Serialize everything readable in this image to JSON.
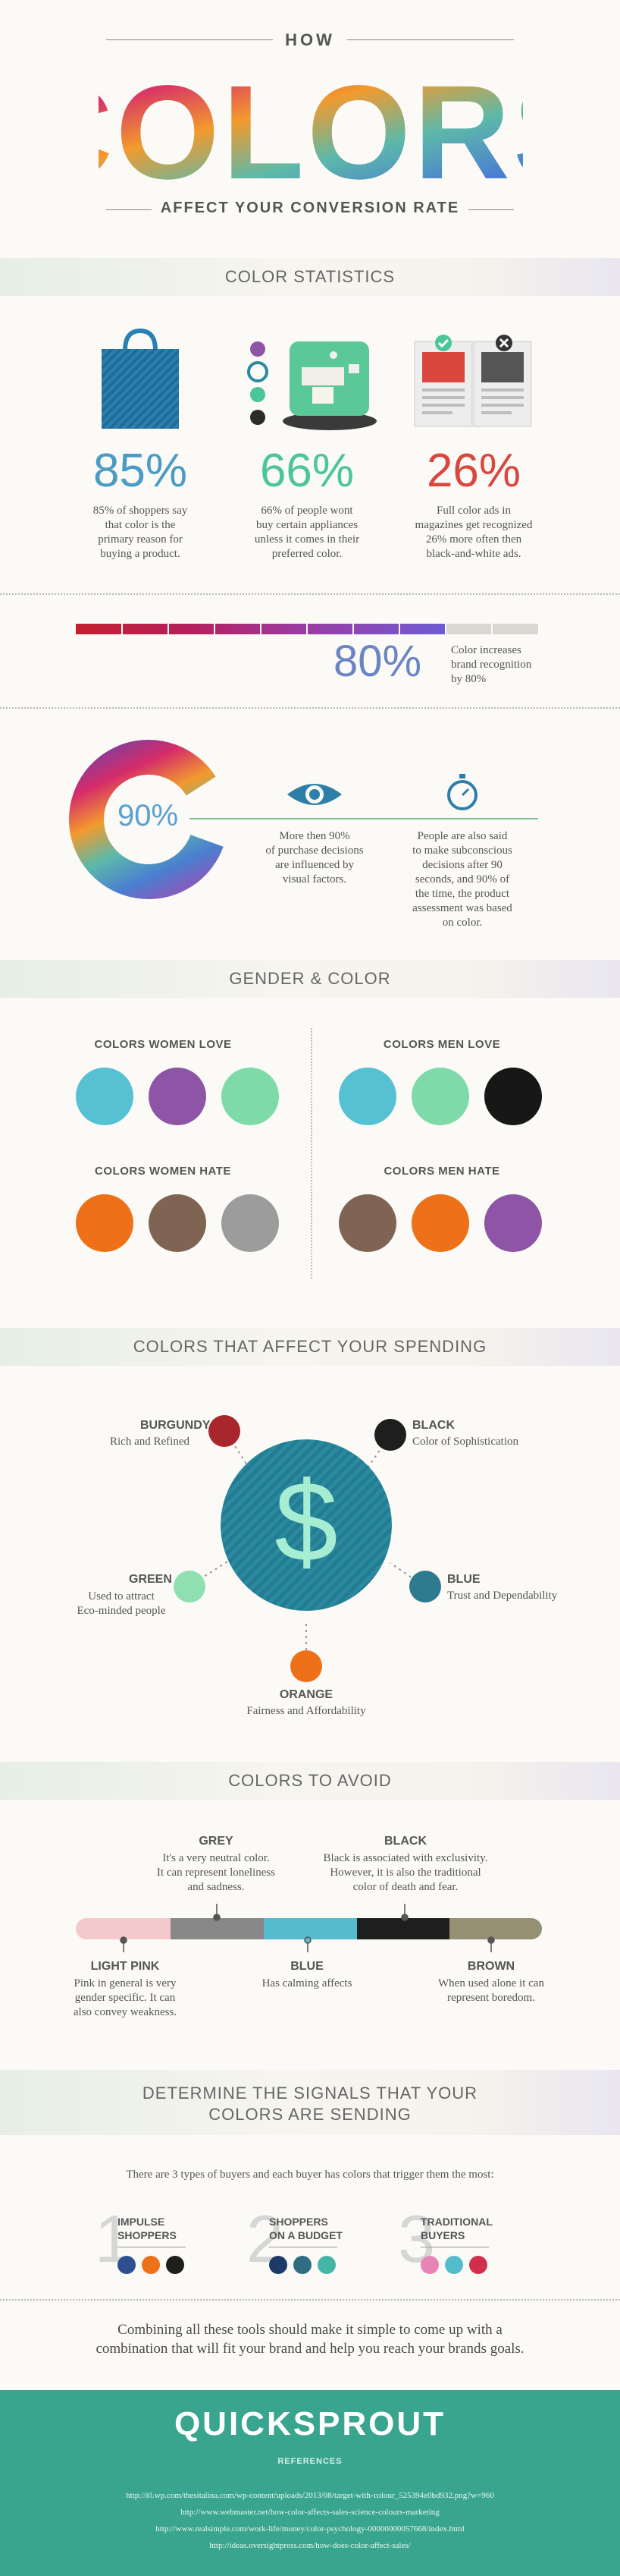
{
  "header": {
    "how": "HOW",
    "colors": "COLORS",
    "subtitle": "AFFECT YOUR CONVERSION RATE"
  },
  "sections": {
    "statistics": "COLOR STATISTICS",
    "gender": "GENDER & COLOR",
    "spending": "COLORS THAT AFFECT YOUR SPENDING",
    "avoid": "COLORS TO AVOID",
    "signals_1": "DETERMINE THE SIGNALS THAT YOUR",
    "signals_2": "COLORS ARE SENDING"
  },
  "stats": [
    {
      "value": "85%",
      "text_1": "85% of shoppers say",
      "text_2": "that color is the",
      "text_3": "primary reason for",
      "text_4": "buying a product.",
      "color": "#4a9cc4"
    },
    {
      "value": "66%",
      "text_1": "66% of people wont",
      "text_2": "buy certain appliances",
      "text_3": "unless it comes in their",
      "text_4": "preferred color.",
      "color": "#4cc59a"
    },
    {
      "value": "26%",
      "text_1": "Full color ads in",
      "text_2": "magazines get recognized",
      "text_3": "26% more often then",
      "text_4": "black-and-white ads.",
      "color": "#d9473f"
    }
  ],
  "brand": {
    "value": "80%",
    "text_1": "Color increases",
    "text_2": "brand recognition",
    "text_3": "by 80%",
    "progress": 0.8
  },
  "purchase": {
    "value": "90%",
    "eye_1": "More then 90%",
    "eye_2": "of purchase decisions",
    "eye_3": "are influenced by",
    "eye_4": "visual factors.",
    "time_1": "People are also said",
    "time_2": "to make subconscious",
    "time_3": "decisions after 90",
    "time_4": "seconds, and 90% of",
    "time_5": "the time, the product",
    "time_6": "assessment was based",
    "time_7": "on color."
  },
  "gender": {
    "women_love": {
      "title": "COLORS WOMEN LOVE",
      "colors": [
        "#56c1d3",
        "#8e55a6",
        "#7fdaa9"
      ]
    },
    "men_love": {
      "title": "COLORS MEN LOVE",
      "colors": [
        "#56c1d3",
        "#7fdaa9",
        "#171717"
      ]
    },
    "women_hate": {
      "title": "COLORS WOMEN HATE",
      "colors": [
        "#ee7119",
        "#7f6453",
        "#9c9c9c"
      ]
    },
    "men_hate": {
      "title": "COLORS MEN HATE",
      "colors": [
        "#7f6453",
        "#ee7119",
        "#8e55a6"
      ]
    }
  },
  "spending": {
    "symbol": "$",
    "burgundy": {
      "label": "BURGUNDY",
      "sub": "Rich and Refined",
      "color": "#a8272d"
    },
    "black": {
      "label": "BLACK",
      "sub": "Color of Sophistication",
      "color": "#1e1e1e"
    },
    "green": {
      "label": "GREEN",
      "sub_1": "Used to attract",
      "sub_2": "Eco-minded people",
      "color": "#8fdfb0"
    },
    "blue": {
      "label": "BLUE",
      "sub": "Trust and Dependability",
      "color": "#2e7a8e"
    },
    "orange": {
      "label": "ORANGE",
      "sub": "Fairness and Affordability",
      "color": "#ee7119"
    }
  },
  "avoid": {
    "grey": {
      "label": "GREY",
      "t1": "It's a very neutral color.",
      "t2": "It can represent loneliness",
      "t3": "and sadness.",
      "color": "#888888"
    },
    "black": {
      "label": "BLACK",
      "t1": "Black is associated with exclusivity.",
      "t2": "However, it is also the traditional",
      "t3": "color of death and fear.",
      "color": "#1e1e1e"
    },
    "light_pink": {
      "label": "LIGHT PINK",
      "t1": "Pink in general is very",
      "t2": "gender specific. It can",
      "t3": "also convey weakness.",
      "color": "#f4c9cc"
    },
    "blue": {
      "label": "BLUE",
      "t1": "Has calming affects",
      "color": "#55bccd"
    },
    "brown": {
      "label": "BROWN",
      "t1": "When used alone it can",
      "t2": "represent boredom.",
      "color": "#958f74"
    }
  },
  "signals": {
    "intro": "There are 3 types of buyers and each buyer has colors that trigger them the most:",
    "buyers": [
      {
        "num": "1",
        "l1": "IMPULSE",
        "l2": "SHOPPERS",
        "colors": [
          "#2d4f8f",
          "#ee7119",
          "#1e1e1e"
        ]
      },
      {
        "num": "2",
        "l1": "SHOPPERS",
        "l2": "ON A BUDGET",
        "colors": [
          "#1e3a68",
          "#2e6e80",
          "#45b5a5"
        ]
      },
      {
        "num": "3",
        "l1": "TRADITIONAL",
        "l2": "BUYERS",
        "colors": [
          "#e884b5",
          "#55bccd",
          "#d12f4c"
        ]
      }
    ]
  },
  "closing": {
    "l1": "Combining all these tools should make it simple to come up with a",
    "l2": "combination that will fit your brand and help you reach your brands goals."
  },
  "footer": {
    "brand": "QUICKSPROUT",
    "references": "REFERENCES",
    "r1": "http://i0.wp.com/thesitalina.com/wp-content/uploads/2013/08/target-with-colour_525394e0bd932.png?w=960",
    "r2": "http://www.webmaster.net/how-color-affects-sales-science-colours-marketing",
    "r3": "http://www.realsimple.com/work-life/money/color-psychology-00000000057668/index.html",
    "r4": "http://ideas.oversightpress.com/how-does-color-affect-sales/",
    "color": "#3aa58e"
  }
}
